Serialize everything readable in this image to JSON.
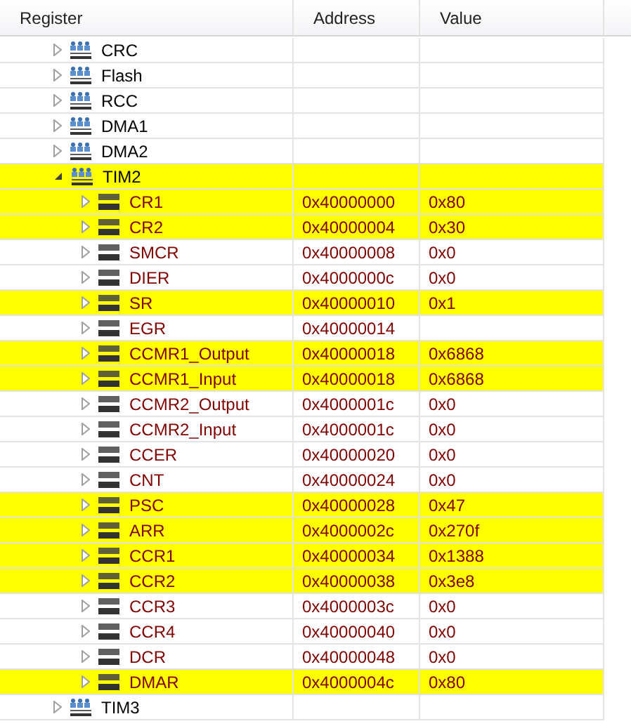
{
  "table": {
    "columns": [
      "Register",
      "Address",
      "Value"
    ],
    "rows": [
      {
        "kind": "peripheral",
        "name": "CRC",
        "expanded": false,
        "changed": false
      },
      {
        "kind": "peripheral",
        "name": "Flash",
        "expanded": false,
        "changed": false
      },
      {
        "kind": "peripheral",
        "name": "RCC",
        "expanded": false,
        "changed": false
      },
      {
        "kind": "peripheral",
        "name": "DMA1",
        "expanded": false,
        "changed": false
      },
      {
        "kind": "peripheral",
        "name": "DMA2",
        "expanded": false,
        "changed": false
      },
      {
        "kind": "peripheral",
        "name": "TIM2",
        "expanded": true,
        "changed": true,
        "children": [
          {
            "kind": "register",
            "name": "CR1",
            "address": "0x40000000",
            "value": "0x80",
            "expanded": false,
            "changed": true
          },
          {
            "kind": "register",
            "name": "CR2",
            "address": "0x40000004",
            "value": "0x30",
            "expanded": false,
            "changed": true
          },
          {
            "kind": "register",
            "name": "SMCR",
            "address": "0x40000008",
            "value": "0x0",
            "expanded": false,
            "changed": false
          },
          {
            "kind": "register",
            "name": "DIER",
            "address": "0x4000000c",
            "value": "0x0",
            "expanded": false,
            "changed": false
          },
          {
            "kind": "register",
            "name": "SR",
            "address": "0x40000010",
            "value": "0x1",
            "expanded": false,
            "changed": true
          },
          {
            "kind": "register",
            "name": "EGR",
            "address": "0x40000014",
            "expanded": false,
            "changed": false
          },
          {
            "kind": "register",
            "name": "CCMR1_Output",
            "address": "0x40000018",
            "value": "0x6868",
            "expanded": false,
            "changed": true
          },
          {
            "kind": "register",
            "name": "CCMR1_Input",
            "address": "0x40000018",
            "value": "0x6868",
            "expanded": false,
            "changed": true
          },
          {
            "kind": "register",
            "name": "CCMR2_Output",
            "address": "0x4000001c",
            "value": "0x0",
            "expanded": false,
            "changed": false
          },
          {
            "kind": "register",
            "name": "CCMR2_Input",
            "address": "0x4000001c",
            "value": "0x0",
            "expanded": false,
            "changed": false
          },
          {
            "kind": "register",
            "name": "CCER",
            "address": "0x40000020",
            "value": "0x0",
            "expanded": false,
            "changed": false
          },
          {
            "kind": "register",
            "name": "CNT",
            "address": "0x40000024",
            "value": "0x0",
            "expanded": false,
            "changed": false
          },
          {
            "kind": "register",
            "name": "PSC",
            "address": "0x40000028",
            "value": "0x47",
            "expanded": false,
            "changed": true
          },
          {
            "kind": "register",
            "name": "ARR",
            "address": "0x4000002c",
            "value": "0x270f",
            "expanded": false,
            "changed": true
          },
          {
            "kind": "register",
            "name": "CCR1",
            "address": "0x40000034",
            "value": "0x1388",
            "expanded": false,
            "changed": true
          },
          {
            "kind": "register",
            "name": "CCR2",
            "address": "0x40000038",
            "value": "0x3e8",
            "expanded": false,
            "changed": true
          },
          {
            "kind": "register",
            "name": "CCR3",
            "address": "0x4000003c",
            "value": "0x0",
            "expanded": false,
            "changed": false
          },
          {
            "kind": "register",
            "name": "CCR4",
            "address": "0x40000040",
            "value": "0x0",
            "expanded": false,
            "changed": false
          },
          {
            "kind": "register",
            "name": "DCR",
            "address": "0x40000048",
            "value": "0x0",
            "expanded": false,
            "changed": false
          },
          {
            "kind": "register",
            "name": "DMAR",
            "address": "0x4000004c",
            "value": "0x80",
            "expanded": false,
            "changed": true
          }
        ]
      },
      {
        "kind": "peripheral",
        "name": "TIM3",
        "expanded": false,
        "changed": false
      }
    ]
  }
}
